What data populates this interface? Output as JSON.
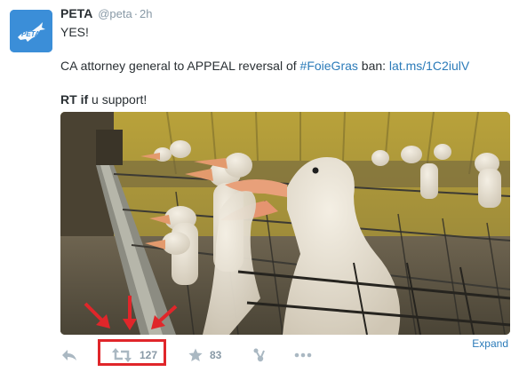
{
  "tweet": {
    "author_name": "PETA",
    "author_handle": "@peta",
    "separator": "·",
    "time": "2h",
    "line1": "YES!",
    "line2_prefix": "CA attorney general to APPEAL reversal of ",
    "hashtag": "#FoieGras",
    "line2_mid": " ban: ",
    "url": "lat.ms/1C2iulV",
    "line3_bold_rt": "RT",
    "line3_bold_if": "if",
    "line3_rest": " u support!"
  },
  "actions": {
    "retweet_count": "127",
    "favorite_count": "83",
    "expand_label": "Expand"
  },
  "colors": {
    "avatar_bg": "#3b8ed8",
    "link": "#2b7bb9",
    "highlight": "#e0262a",
    "icon": "#aab8c2"
  },
  "icons": {
    "avatar": "peta-logo-icon",
    "reply": "reply-icon",
    "retweet": "retweet-icon",
    "favorite": "star-icon",
    "share": "share-icon",
    "more": "more-dots-icon"
  },
  "avatar_text": "PETA"
}
